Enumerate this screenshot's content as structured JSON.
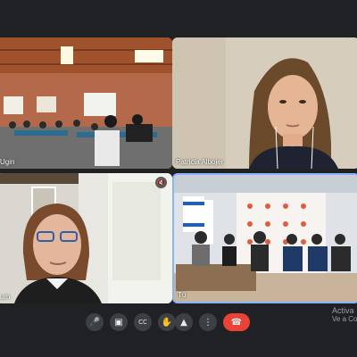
{
  "participants": [
    {
      "name": "Ugin"
    },
    {
      "name": "Patricia Albojer"
    },
    {
      "name": "um"
    },
    {
      "name": "Tú"
    }
  ],
  "controls": {
    "microphone": "microphone-icon",
    "camera": "camera-icon",
    "captions": "captions-icon",
    "raise_hand": "raise-hand-icon",
    "present": "present-screen-icon",
    "more": "more-options-icon",
    "end_call": "end-call-icon"
  },
  "watermark": {
    "line1": "Activa",
    "line2": "Ve a Co"
  },
  "colors": {
    "background": "#202124",
    "end_call": "#ea4335",
    "active_speaker": "#8ab4f8"
  }
}
